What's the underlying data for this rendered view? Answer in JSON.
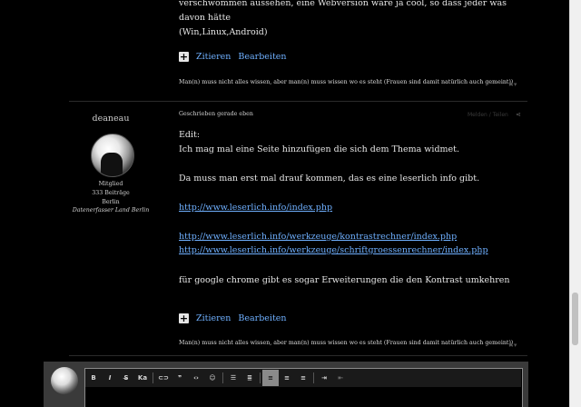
{
  "previous_post": {
    "text_line1": "verschwommen aussehen, eine Webversion wäre ja cool, so dass jeder was davon hätte",
    "text_line2": "(Win,Linux,Android)",
    "quote_label": "Zitieren",
    "edit_label": "Bearbeiten",
    "signature": "Man(n) muss nicht alles wissen, aber man(n) muss wissen wo es steht (Frauen sind damit natürlich auch gemeint))"
  },
  "post": {
    "author": "deaneau",
    "role": "Mitglied",
    "posts_count": "333 Beiträge",
    "city": "Berlin",
    "tagline": "Datenerfasser Land Berlin",
    "date": "Geschrieben gerade eben",
    "ghost_label": "Melden / Teilen",
    "lines": {
      "l1": "Edit:",
      "l2": "Ich mag mal eine Seite hinzufügen die sich dem Thema widmet.",
      "l3": "Da muss man erst mal drauf kommen, das es eine leserlich info gibt.",
      "l4": "für google chrome gibt es sogar Erweiterungen die den Kontrast umkehren"
    },
    "links": {
      "link1": "http://www.leserlich.info/index.php",
      "link2": "http://www.leserlich.info/werkzeuge/kontrastrechner/index.php",
      "link3": "http://www.leserlich.info/werkzeuge/schriftgroessenrechner/index.php"
    },
    "quote_label": "Zitieren",
    "edit_label": "Bearbeiten",
    "signature": "Man(n) muss nicht alles wissen, aber man(n) muss wissen wo es steht (Frauen sind damit natürlich auch gemeint))"
  },
  "icons": {
    "plus": "+",
    "close_dropdown": "✖▾",
    "share": "⋖"
  },
  "editor_toolbar": {
    "bold": "B",
    "italic": "I",
    "strike": "S̶",
    "font_size": "Ka",
    "link": "⊂⊃",
    "quote": "❞",
    "code": "‹›",
    "emoji": "☺",
    "bullet_list": "☰",
    "numbered_list": "≣",
    "align_left": "≡",
    "align_center": "≡",
    "align_right": "≡",
    "indent": "⇥",
    "outdent": "⇤"
  },
  "colors": {
    "link": "#6fb0ff",
    "background": "#000000"
  }
}
